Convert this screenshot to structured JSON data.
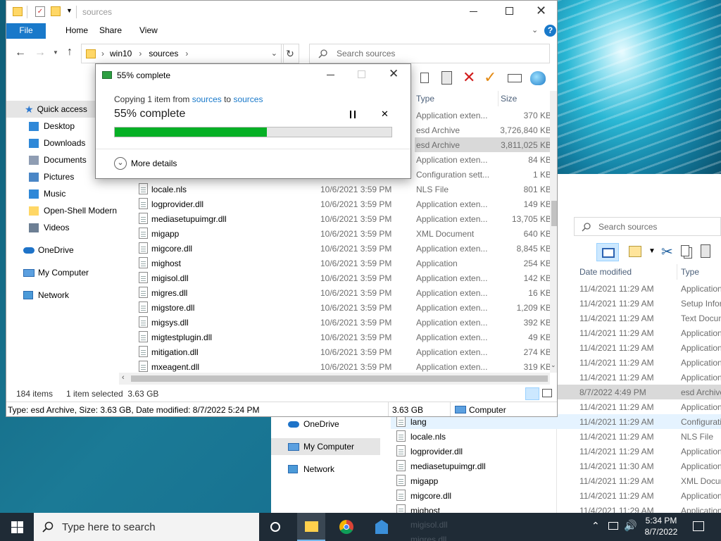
{
  "window": {
    "title": "sources",
    "ribbon_tabs": [
      "File",
      "Home",
      "Share",
      "View"
    ],
    "breadcrumb": [
      "win10",
      "sources"
    ],
    "search_placeholder": "Search sources",
    "status_items": "184 items",
    "status_selected": "1 item selected  3.63 GB",
    "details_bar_left": "Type: esd Archive, Size: 3.63 GB, Date modified: 8/7/2022 5:24 PM",
    "details_bar_size": "3.63 GB",
    "details_bar_location": "Computer"
  },
  "nav": {
    "quick_access": "Quick access",
    "items": [
      "Desktop",
      "Downloads",
      "Documents",
      "Pictures",
      "Music",
      "Open-Shell Modern",
      "Videos"
    ],
    "onedrive": "OneDrive",
    "my_computer": "My Computer",
    "network": "Network"
  },
  "columns": {
    "type": "Type",
    "size": "Size"
  },
  "top_rows": [
    {
      "type": "Application exten...",
      "size": "370 KB"
    },
    {
      "type": "esd Archive",
      "size": "3,726,840 KB"
    },
    {
      "type": "esd Archive",
      "size": "3,811,025 KB",
      "selected": true
    },
    {
      "type": "Application exten...",
      "size": "84 KB"
    },
    {
      "type": "Configuration sett...",
      "size": "1 KB"
    }
  ],
  "rows": [
    {
      "name": "locale.nls",
      "date": "10/6/2021 3:59 PM",
      "type": "NLS File",
      "size": "801 KB"
    },
    {
      "name": "logprovider.dll",
      "date": "10/6/2021 3:59 PM",
      "type": "Application exten...",
      "size": "149 KB"
    },
    {
      "name": "mediasetupuimgr.dll",
      "date": "10/6/2021 3:59 PM",
      "type": "Application exten...",
      "size": "13,705 KB"
    },
    {
      "name": "migapp",
      "date": "10/6/2021 3:59 PM",
      "type": "XML Document",
      "size": "640 KB"
    },
    {
      "name": "migcore.dll",
      "date": "10/6/2021 3:59 PM",
      "type": "Application exten...",
      "size": "8,845 KB"
    },
    {
      "name": "mighost",
      "date": "10/6/2021 3:59 PM",
      "type": "Application",
      "size": "254 KB"
    },
    {
      "name": "migisol.dll",
      "date": "10/6/2021 3:59 PM",
      "type": "Application exten...",
      "size": "142 KB"
    },
    {
      "name": "migres.dll",
      "date": "10/6/2021 3:59 PM",
      "type": "Application exten...",
      "size": "16 KB"
    },
    {
      "name": "migstore.dll",
      "date": "10/6/2021 3:59 PM",
      "type": "Application exten...",
      "size": "1,209 KB"
    },
    {
      "name": "migsys.dll",
      "date": "10/6/2021 3:59 PM",
      "type": "Application exten...",
      "size": "392 KB"
    },
    {
      "name": "migtestplugin.dll",
      "date": "10/6/2021 3:59 PM",
      "type": "Application exten...",
      "size": "49 KB"
    },
    {
      "name": "mitigation.dll",
      "date": "10/6/2021 3:59 PM",
      "type": "Application exten...",
      "size": "274 KB"
    },
    {
      "name": "mxeagent.dll",
      "date": "10/6/2021 3:59 PM",
      "type": "Application exten...",
      "size": "319 KB"
    }
  ],
  "dialog": {
    "title": "55% complete",
    "copy_prefix": "Copying 1 item from",
    "from": "sources",
    "to_word": "to",
    "to": "sources",
    "heading": "55% complete",
    "progress": 0.55,
    "more_details": "More details"
  },
  "win2": {
    "search_placeholder": "Search sources",
    "col_date": "Date modified",
    "col_type": "Type",
    "nav": {
      "onedrive": "OneDrive",
      "my_computer": "My Computer",
      "network": "Network"
    },
    "rows": [
      {
        "name": "",
        "date": "11/4/2021 11:29 AM",
        "type": "Application"
      },
      {
        "name": "",
        "date": "11/4/2021 11:29 AM",
        "type": "Setup Inform"
      },
      {
        "name": "",
        "date": "11/4/2021 11:29 AM",
        "type": "Text Docum"
      },
      {
        "name": "",
        "date": "11/4/2021 11:29 AM",
        "type": "Application"
      },
      {
        "name": "",
        "date": "11/4/2021 11:29 AM",
        "type": "Application"
      },
      {
        "name": "",
        "date": "11/4/2021 11:29 AM",
        "type": "Application"
      },
      {
        "name": "",
        "date": "11/4/2021 11:29 AM",
        "type": "Application"
      },
      {
        "name": "",
        "date": "8/7/2022 4:49 PM",
        "type": "esd Archive",
        "selected": true
      },
      {
        "name": "",
        "date": "11/4/2021 11:29 AM",
        "type": "Application"
      },
      {
        "name": "lang",
        "date": "11/4/2021 11:29 AM",
        "type": "Configurati",
        "hover": true
      },
      {
        "name": "locale.nls",
        "date": "11/4/2021 11:29 AM",
        "type": "NLS File"
      },
      {
        "name": "logprovider.dll",
        "date": "11/4/2021 11:29 AM",
        "type": "Application"
      },
      {
        "name": "mediasetupuimgr.dll",
        "date": "11/4/2021 11:30 AM",
        "type": "Application"
      },
      {
        "name": "migapp",
        "date": "11/4/2021 11:29 AM",
        "type": "XML Docum"
      },
      {
        "name": "migcore.dll",
        "date": "11/4/2021 11:29 AM",
        "type": "Application"
      },
      {
        "name": "mighost",
        "date": "11/4/2021 11:29 AM",
        "type": "Application"
      }
    ]
  },
  "taskbar": {
    "search_placeholder": "Type here to search",
    "time": "5:34 PM",
    "date": "8/7/2022",
    "behind_items": [
      "migisol.dll",
      "migres.dll"
    ]
  },
  "colors": {
    "accent": "#1979ca",
    "progress": "#06b025",
    "selection": "#cce8ff",
    "taskbar": "#1f2b36"
  },
  "icons": [
    "folder-icon",
    "search-icon",
    "refresh-icon",
    "close-icon",
    "pause-icon",
    "help-icon",
    "windows-logo-icon",
    "chrome-icon"
  ]
}
